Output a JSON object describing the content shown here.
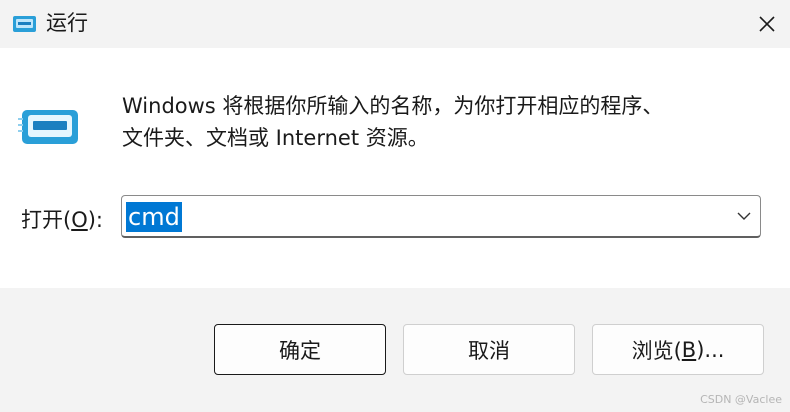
{
  "window": {
    "title": "运行",
    "icon": "run-icon",
    "close_icon": "close-icon"
  },
  "content": {
    "description_lines": [
      "Windows 将根据你所输入的名称，为你打开相应的程序、",
      "文件夹、文档或 Internet 资源。"
    ],
    "open_label": {
      "before": "打开(",
      "accel": "O",
      "after": "):"
    },
    "open_input_value": "cmd",
    "dropdown_icon": "chevron-down-icon"
  },
  "buttons": {
    "ok": "确定",
    "cancel": "取消",
    "browse": {
      "before": "浏览(",
      "accel": "B",
      "after": ")..."
    }
  },
  "watermark": "CSDN @Vaclee",
  "colors": {
    "selection": "#0078d4",
    "titlebar_bg": "#f3f3f3",
    "footer_bg": "#f3f3f3",
    "content_bg": "#ffffff"
  }
}
